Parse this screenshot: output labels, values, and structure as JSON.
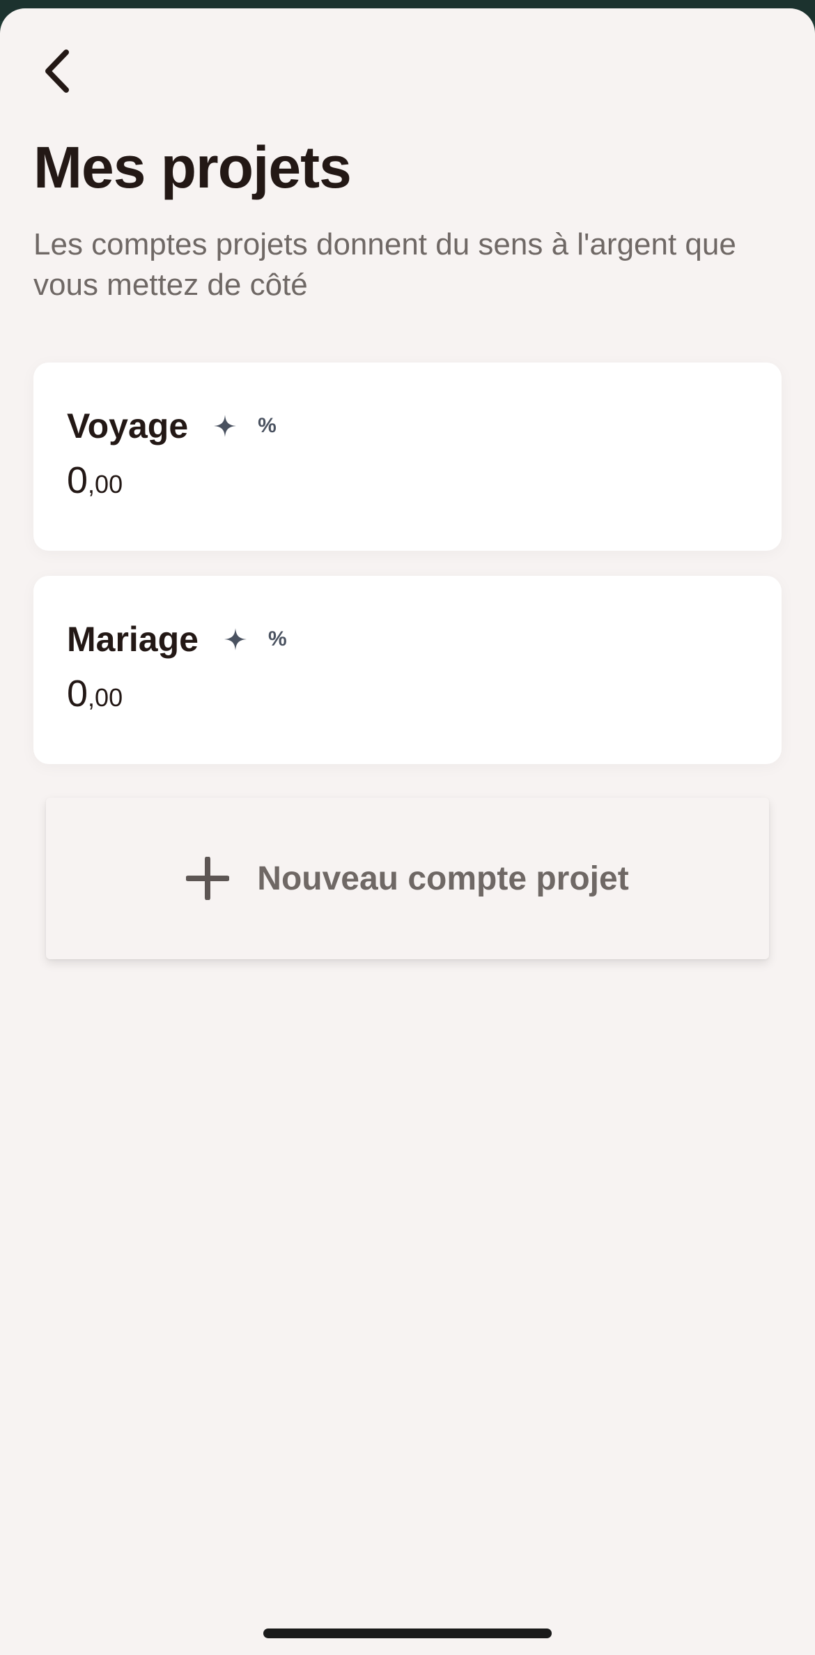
{
  "header": {
    "back_icon": "chevron-left-icon",
    "title": "Mes projets",
    "subtitle": "Les comptes projets donnent du sens à l'argent que vous mettez de côté"
  },
  "projects": [
    {
      "name": "Voyage",
      "amount_int": "0",
      "amount_dec": ",00",
      "sparkle_icon": "sparkle-icon",
      "percent": "%"
    },
    {
      "name": "Mariage",
      "amount_int": "0",
      "amount_dec": ",00",
      "sparkle_icon": "sparkle-icon",
      "percent": "%"
    }
  ],
  "new_project": {
    "icon": "plus-icon",
    "label": "Nouveau compte projet"
  },
  "colors": {
    "background": "#f7f3f2",
    "text_primary": "#231815",
    "text_secondary": "#6f6865",
    "icon_accent": "#4a5260",
    "card": "#ffffff"
  }
}
